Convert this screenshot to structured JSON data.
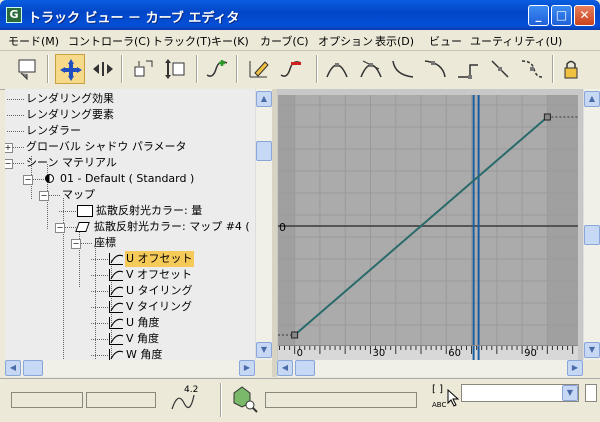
{
  "window": {
    "title": "トラック ビュー － カーブ エディタ",
    "app_icon_glyph": "G",
    "controls": {
      "minimize": "_",
      "maximize": "□",
      "close": "✕"
    }
  },
  "menu": [
    "モード(M)",
    "コントローラ(C)",
    "トラック(T)",
    "キー(K)",
    "カーブ(C)",
    "オプション",
    "表示(D)",
    "ビュー",
    "ユーティリティ(U)"
  ],
  "tree": {
    "rows": [
      "レンダリング効果",
      "レンダリング要素",
      "レンダラー",
      "グローバル シャドウ パラメータ",
      "シーン マテリアル",
      "01 - Default ( Standard )",
      "マップ",
      "拡散反射光カラー: 量",
      "拡散反射光カラー: マップ #4 (",
      "座標",
      "U オフセット",
      "V オフセット",
      "U タイリング",
      "V タイリング",
      "U 角度",
      "V 角度",
      "W 角度"
    ],
    "selected_index": 10
  },
  "graph": {
    "y_label": "0",
    "ruler_labels": [
      "0",
      "30",
      "60",
      "90"
    ]
  },
  "chart_data": {
    "type": "line",
    "series": [
      {
        "points": [
          [
            0,
            0
          ],
          [
            100,
            1
          ]
        ]
      }
    ],
    "xlim": [
      -5,
      105
    ],
    "current_frame": 72
  },
  "status": {
    "curve_label": "4.2",
    "abc_label": "ABC",
    "bracket_label": "[ ]"
  },
  "colors": {
    "curve": "#2a6a6a",
    "time_slider": "#1a5ea0",
    "selected": "#f6ca58",
    "graph_bg": "#ababab"
  }
}
